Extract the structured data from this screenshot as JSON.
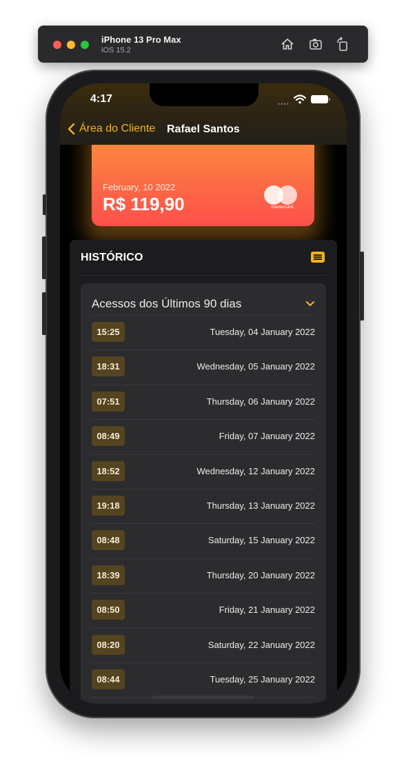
{
  "simulator": {
    "device": "iPhone 13 Pro Max",
    "os": "iOS 15.2",
    "icons": [
      "home-icon",
      "screenshot-icon",
      "rotate-icon"
    ]
  },
  "status_bar": {
    "time": "4:17"
  },
  "nav": {
    "back_label": "Área do Cliente",
    "title": "Rafael Santos"
  },
  "card": {
    "date": "February, 10 2022",
    "amount": "R$ 119,90",
    "brand": "mastercard."
  },
  "history": {
    "title": "HISTÓRICO",
    "section_title": "Acessos dos Últimos 90 dias",
    "rows": [
      {
        "time": "15:25",
        "date": "Tuesday, 04 January 2022"
      },
      {
        "time": "18:31",
        "date": "Wednesday, 05 January 2022"
      },
      {
        "time": "07:51",
        "date": "Thursday, 06 January 2022"
      },
      {
        "time": "08:49",
        "date": "Friday, 07 January 2022"
      },
      {
        "time": "18:52",
        "date": "Wednesday, 12 January 2022"
      },
      {
        "time": "19:18",
        "date": "Thursday, 13 January 2022"
      },
      {
        "time": "08:48",
        "date": "Saturday, 15 January 2022"
      },
      {
        "time": "18:39",
        "date": "Thursday, 20 January 2022"
      },
      {
        "time": "08:50",
        "date": "Friday, 21 January 2022"
      },
      {
        "time": "08:20",
        "date": "Saturday, 22 January 2022"
      },
      {
        "time": "08:44",
        "date": "Tuesday, 25 January 2022"
      }
    ]
  },
  "colors": {
    "accent": "#f2b51c",
    "card_top": "#fb8f3b",
    "card_bottom": "#fe4f4b",
    "panel_bg": "#1c1c1e",
    "time_badge": "#54441f"
  }
}
